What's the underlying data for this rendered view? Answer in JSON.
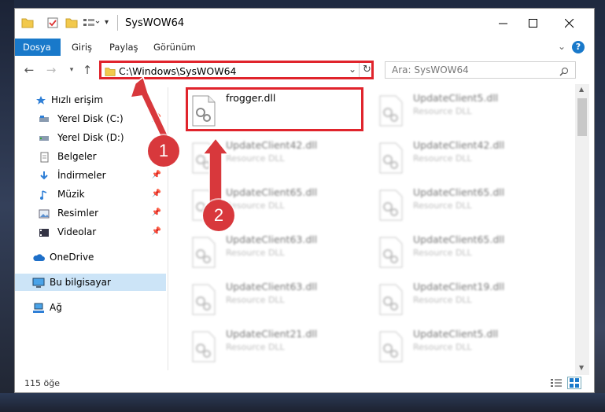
{
  "window": {
    "title": "SysWOW64"
  },
  "ribbon": {
    "tabs": [
      "Dosya",
      "Giriş",
      "Paylaş",
      "Görünüm"
    ]
  },
  "address": {
    "path": "C:\\Windows\\SysWOW64"
  },
  "search": {
    "placeholder": "Ara: SysWOW64"
  },
  "sidebar": {
    "items": [
      {
        "label": "Hızlı erişim"
      },
      {
        "label": "Yerel Disk (C:)"
      },
      {
        "label": "Yerel Disk (D:)"
      },
      {
        "label": "Belgeler"
      },
      {
        "label": "İndirmeler"
      },
      {
        "label": "Müzik"
      },
      {
        "label": "Resimler"
      },
      {
        "label": "Videolar"
      },
      {
        "label": "OneDrive"
      },
      {
        "label": "Bu bilgisayar"
      },
      {
        "label": "Ağ"
      }
    ]
  },
  "files": [
    {
      "name": "frogger.dll",
      "type": ""
    },
    {
      "name": "UpdateClient5.dll",
      "type": "Resource DLL"
    },
    {
      "name": "UpdateClient42.dll",
      "type": "Resource DLL"
    },
    {
      "name": "UpdateClient42.dll",
      "type": "Resource DLL"
    },
    {
      "name": "UpdateClient65.dll",
      "type": "Resource DLL"
    },
    {
      "name": "UpdateClient65.dll",
      "type": "Resource DLL"
    },
    {
      "name": "UpdateClient63.dll",
      "type": "Resource DLL"
    },
    {
      "name": "UpdateClient65.dll",
      "type": "Resource DLL"
    },
    {
      "name": "UpdateClient63.dll",
      "type": "Resource DLL"
    },
    {
      "name": "UpdateClient19.dll",
      "type": "Resource DLL"
    },
    {
      "name": "UpdateClient21.dll",
      "type": "Resource DLL"
    },
    {
      "name": "UpdateClient5.dll",
      "type": "Resource DLL"
    }
  ],
  "status": {
    "count": "115 öğe"
  },
  "annotations": {
    "one": "1",
    "two": "2"
  },
  "colors": {
    "accent": "#1979ca",
    "highlight": "#e0242c",
    "badge": "#d8383c"
  }
}
